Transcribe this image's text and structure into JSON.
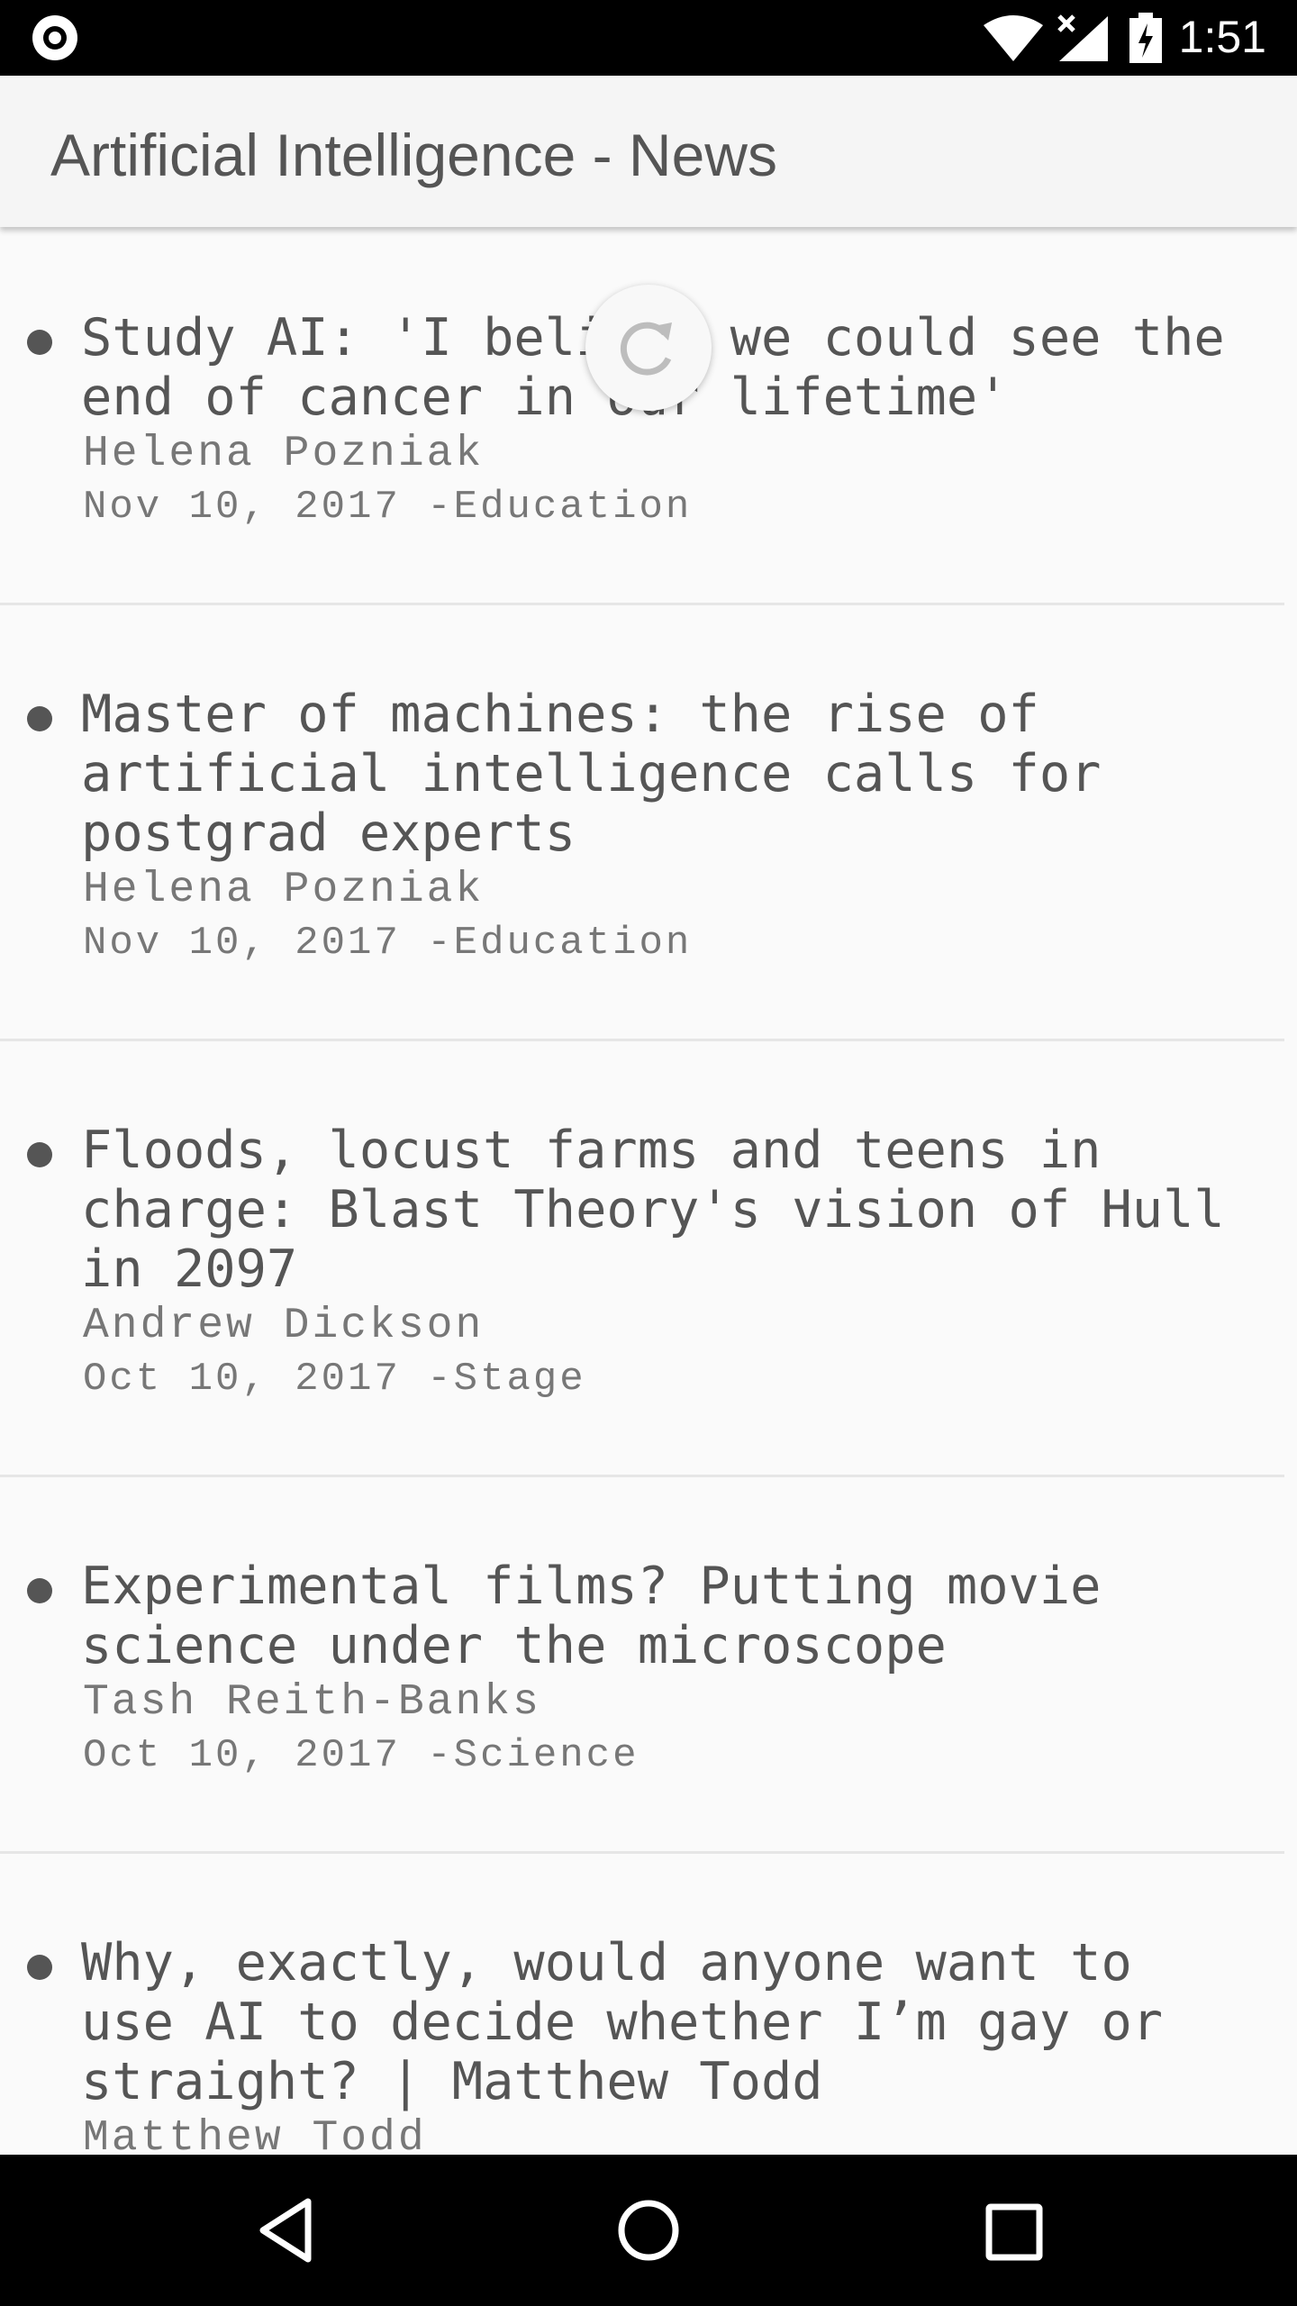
{
  "status_bar": {
    "time": "1:51",
    "icons": [
      "camera-icon",
      "wifi-icon",
      "signal-icon",
      "battery-icon"
    ]
  },
  "app_bar": {
    "title": "Artificial Intelligence - News"
  },
  "articles": [
    {
      "headline": "Study AI: 'I believe we could see the end of cancer in our lifetime'",
      "author": "Helena Pozniak",
      "meta": "Nov 10, 2017  -Education"
    },
    {
      "headline": "Master of machines: the rise of artificial intelligence calls for postgrad experts",
      "author": "Helena Pozniak",
      "meta": "Nov 10, 2017  -Education"
    },
    {
      "headline": "Floods, locust farms and teens in charge: Blast Theory's vision of Hull in 2097",
      "author": "Andrew Dickson",
      "meta": "Oct 10, 2017  -Stage"
    },
    {
      "headline": "Experimental films? Putting movie science under the microscope",
      "author": "Tash Reith-Banks",
      "meta": "Oct 10, 2017  -Science"
    },
    {
      "headline": "Why, exactly, would anyone want to use AI to decide whether I’m gay or straight? | Matthew Todd",
      "author": "Matthew Todd",
      "meta": ""
    }
  ],
  "nav_bar": {
    "icons": [
      "back-icon",
      "home-icon",
      "recent-apps-icon"
    ]
  },
  "colors": {
    "background": "#fafafa",
    "text": "#555555",
    "secondary_text": "#777777",
    "app_bar": "#f5f5f5"
  }
}
